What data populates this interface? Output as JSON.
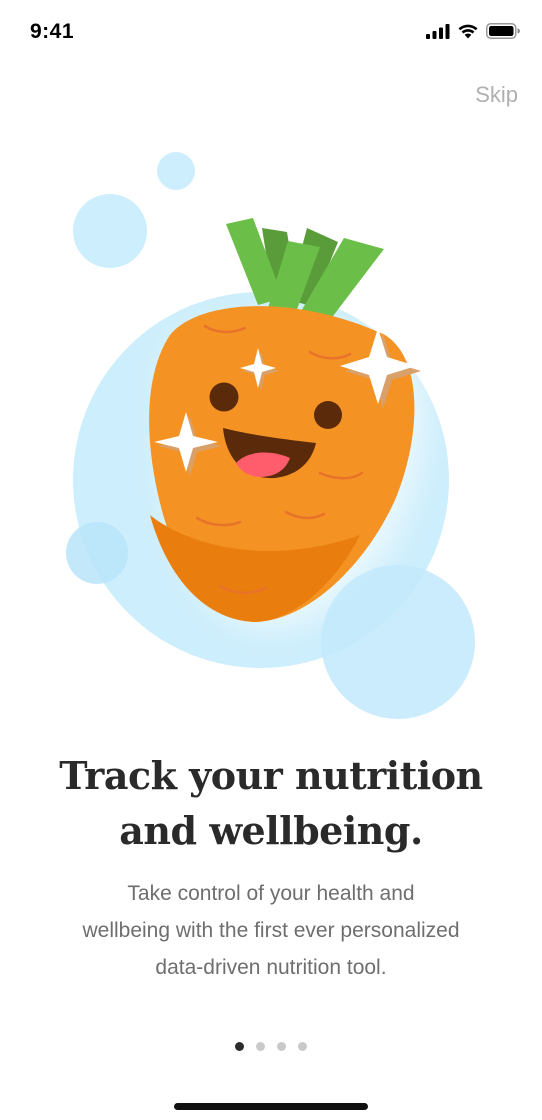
{
  "status_bar": {
    "time": "9:41"
  },
  "header": {
    "skip_label": "Skip"
  },
  "onboarding": {
    "headline_line1": "Track your nutrition",
    "headline_line2": "and wellbeing.",
    "description_line1": "Take control of your health and",
    "description_line2": "wellbeing with the first ever personalized",
    "description_line3": "data-driven nutrition tool."
  },
  "pager": {
    "total_pages": 4,
    "current_page": 1
  },
  "colors": {
    "bubble_blue": "#cdeefc",
    "carrot_orange": "#f49323",
    "carrot_shadow": "#e97e0f",
    "leaf_green": "#6bbf48",
    "leaf_dark_green": "#5a9c3a",
    "mouth_pink": "#ff5c6c",
    "eye_brown": "#5a2a0a",
    "text_dark": "#2a2a2a",
    "text_muted": "#6e6e6e",
    "skip_gray": "#b0b0b0"
  }
}
